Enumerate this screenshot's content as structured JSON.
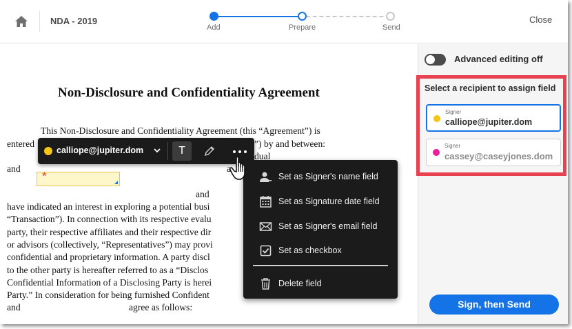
{
  "header": {
    "title": "NDA - 2019",
    "close_label": "Close",
    "steps": [
      {
        "label": "Add",
        "state": "complete"
      },
      {
        "label": "Prepare",
        "state": "current"
      },
      {
        "label": "Send",
        "state": "pending"
      }
    ]
  },
  "document": {
    "heading": "Non-Disclosure and Confidentiality Agreement",
    "lines": [
      "This Non-Disclosure and Confidentiality Agreement (this “Agreement”) is",
      "entered",
      "”) by and between:",
      "dual",
      "and",
      "a",
      "and",
      "have indicated an interest in exploring a potential busi",
      "“Transaction”). In connection with its respective evalu",
      "party, their respective affiliates and their respective dir",
      "or advisors (collectively, “Representatives”) may provi",
      "confidential and proprietary information. A party discl",
      "to the other party is hereafter referred to as a “Disclos",
      "Confidential Information of a Disclosing Party is herei",
      "Party.” In consideration for being furnished Confident",
      "and",
      "agree as follows:"
    ],
    "field_marker": "*"
  },
  "toolbar": {
    "recipient_email": "calliope@jupiter.dom",
    "recipient_color": "#f5c518",
    "text_button": "T",
    "icons": [
      "chevron-down-icon",
      "pen-icon",
      "more-icon"
    ]
  },
  "context_menu": {
    "items": [
      {
        "label": "Set as Signer's name field",
        "icon": "person-icon"
      },
      {
        "label": "Set as Signature date field",
        "icon": "calendar-icon"
      },
      {
        "label": "Set as Signer's email field",
        "icon": "envelope-icon"
      },
      {
        "label": "Set as checkbox",
        "icon": "checkbox-icon"
      },
      {
        "label": "Delete field",
        "icon": "trash-icon"
      }
    ]
  },
  "panel": {
    "toggle_label": "Advanced editing off",
    "recipients_title": "Select a recipient to assign field",
    "recipients": [
      {
        "role": "Signer",
        "email": "calliope@jupiter.dom",
        "color": "#f5c518",
        "selected": true
      },
      {
        "role": "Signer",
        "email": "cassey@caseyjones.dom",
        "color": "#e91e9b",
        "selected": false
      }
    ],
    "primary_button": "Sign, then Send"
  }
}
